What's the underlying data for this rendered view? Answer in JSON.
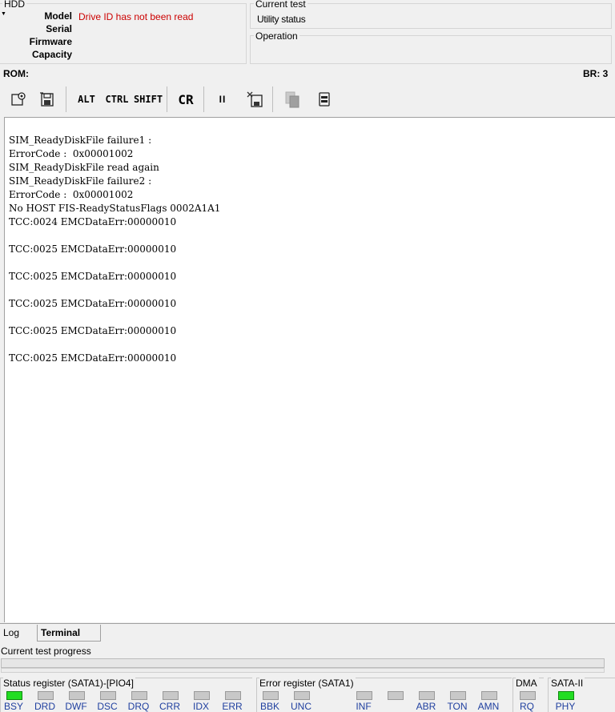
{
  "hdd": {
    "title": "HDD",
    "labels": [
      "Model",
      "Serial",
      "Firmware",
      "Capacity"
    ],
    "model_value": "Drive ID has not been read"
  },
  "current_test": {
    "title": "Current test",
    "value": "Utility status"
  },
  "operation": {
    "title": "Operation"
  },
  "rombar": {
    "rom_label": "ROM:",
    "br_label": "BR: 3"
  },
  "toolbar": {
    "alt": "ALT",
    "ctrl": "CTRL",
    "shift": "SHIFT",
    "cr": "CR",
    "pause": "II"
  },
  "terminal": {
    "lines": [
      "SIM_ReadyDiskFile failure1 :",
      "ErrorCode :  0x00001002",
      "SIM_ReadyDiskFile read again",
      "SIM_ReadyDiskFile failure2 :",
      "ErrorCode :  0x00001002",
      "No HOST FIS-ReadyStatusFlags 0002A1A1",
      "TCC:0024 EMCDataErr:00000010",
      "",
      "TCC:0025 EMCDataErr:00000010",
      "",
      "TCC:0025 EMCDataErr:00000010",
      "",
      "TCC:0025 EMCDataErr:00000010",
      "",
      "TCC:0025 EMCDataErr:00000010",
      "",
      "TCC:0025 EMCDataErr:00000010"
    ]
  },
  "tabs": {
    "log": "Log",
    "terminal": "Terminal"
  },
  "progress": {
    "label": "Current test progress"
  },
  "status_register": {
    "title": "Status register (SATA1)-[PIO4]",
    "bits": [
      {
        "label": "BSY",
        "on": true
      },
      {
        "label": "DRD",
        "on": false
      },
      {
        "label": "DWF",
        "on": false
      },
      {
        "label": "DSC",
        "on": false
      },
      {
        "label": "DRQ",
        "on": false
      },
      {
        "label": "CRR",
        "on": false
      },
      {
        "label": "IDX",
        "on": false
      },
      {
        "label": "ERR",
        "on": false
      }
    ]
  },
  "error_register": {
    "title": "Error register (SATA1)",
    "bits": [
      {
        "label": "BBK",
        "on": false
      },
      {
        "label": "UNC",
        "on": false
      },
      {
        "label": "INF",
        "on": false
      },
      {
        "label": "",
        "on": false
      },
      {
        "label": "ABR",
        "on": false
      },
      {
        "label": "TON",
        "on": false
      },
      {
        "label": "AMN",
        "on": false
      }
    ]
  },
  "dma": {
    "title": "DMA",
    "bit": {
      "label": "RQ",
      "on": false
    }
  },
  "sata": {
    "title": "SATA-II",
    "bit": {
      "label": "PHY",
      "on": true
    }
  }
}
